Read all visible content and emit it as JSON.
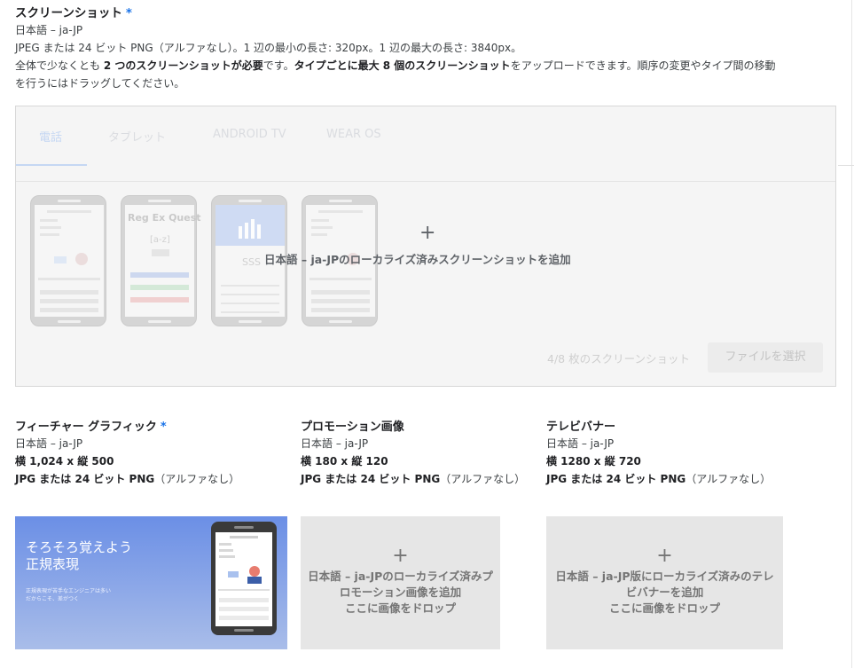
{
  "screenshots": {
    "title": "スクリーンショット",
    "required_mark": "*",
    "language": "日本語 – ja-JP",
    "requirements": "JPEG または 24 ビット PNG（アルファなし）。1 辺の最小の長さ: 320px。1 辺の最大の長さ: 3840px。",
    "note_1a": "全体で少なくとも ",
    "note_1b": "2 つのスクリーンショットが必要",
    "note_1c": "です。",
    "note_1d": "タイプごとに最大 8 個のスクリーンショット",
    "note_1e": "をアップロードできます。順序の変更やタイプ間の移動",
    "note_2": "を行うにはドラッグしてください。",
    "tabs": [
      {
        "label": "電話"
      },
      {
        "label": "タブレット"
      },
      {
        "label": "ANDROID TV"
      },
      {
        "label": "WEAR OS"
      }
    ],
    "thumb_title": "Reg Ex Quest",
    "thumb_regex": "[a-z]",
    "thumb_score": "SSS",
    "add_plus": "+",
    "add_label": "日本語 – ja-JPのローカライズ済みスクリーンショットを追加",
    "count": "4/8 枚のスクリーンショット",
    "choose_file": "ファイルを選択"
  },
  "feature_graphic": {
    "title": "フィーチャー グラフィック",
    "required_mark": "*",
    "language": "日本語 – ja-JP",
    "size_a": "横 1,024 x 縦 500",
    "format_a": "JPG または ",
    "format_b": "24 ビット PNG",
    "format_c": "（アルファなし）",
    "headline_1": "そろそろ覚えよう",
    "headline_2": "正規表現",
    "subtext_1": "正規表現が苦手なエンジニアは多い",
    "subtext_2": "だからこそ、差がつく"
  },
  "promo_image": {
    "title": "プロモーション画像",
    "language": "日本語 – ja-JP",
    "size_a": "横 180 x 縦 120",
    "format_a": "JPG または ",
    "format_b": "24 ビット PNG",
    "format_c": "（アルファなし）",
    "plus": "+",
    "drop_1": "日本語 – ja-JPのローカライズ済みプ",
    "drop_2": "ロモーション画像を追加",
    "drop_3": "ここに画像をドロップ"
  },
  "tv_banner": {
    "title": "テレビバナー",
    "language": "日本語 – ja-JP",
    "size_a": "横 1280 x 縦 720",
    "format_a": "JPG または ",
    "format_b": "24 ビット PNG",
    "format_c": "（アルファなし）",
    "plus": "+",
    "drop_1": "日本語 – ja-JP版にローカライズ済みのテレ",
    "drop_2": "ビバナーを追加",
    "drop_3": "ここに画像をドロップ"
  },
  "colors": {
    "accent": "#1a73e8",
    "feature_gradient_top": "#6b8fe6",
    "feature_gradient_bottom": "#a9bde9"
  }
}
